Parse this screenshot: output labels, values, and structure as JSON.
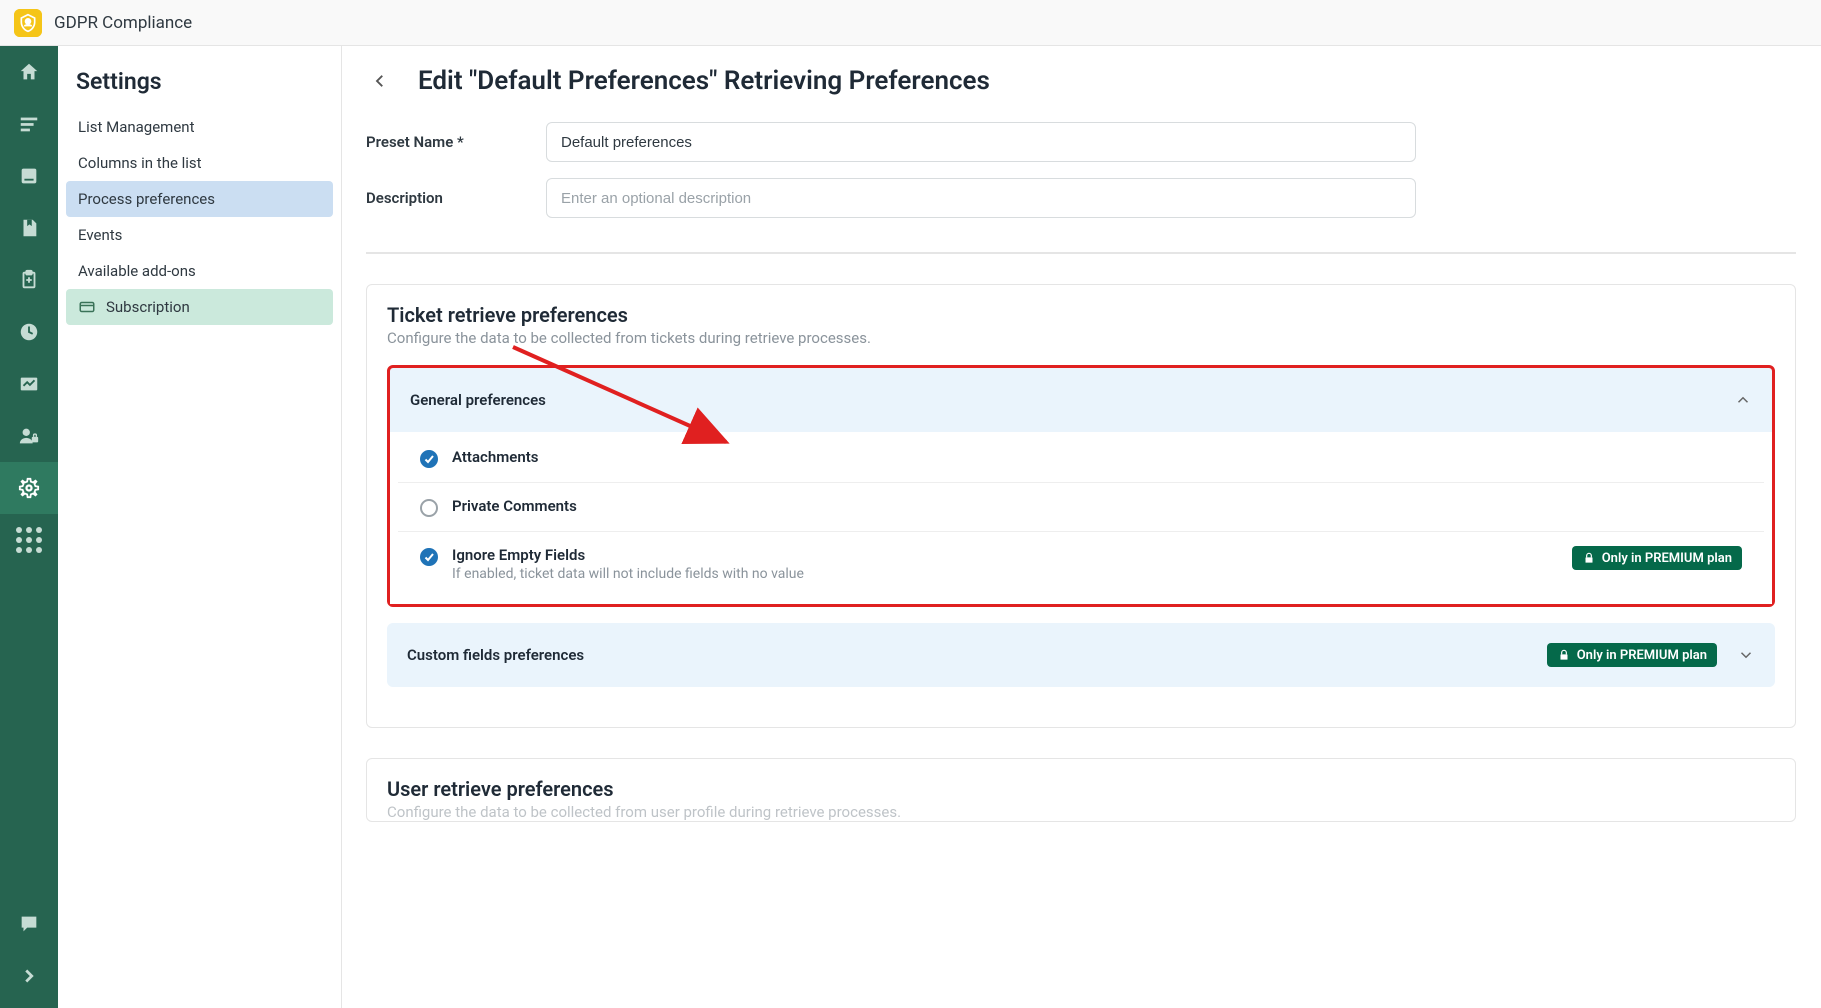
{
  "header": {
    "app_name": "GDPR Compliance"
  },
  "rail": {
    "items_top": [
      {
        "name": "home-icon"
      },
      {
        "name": "list-icon"
      },
      {
        "name": "card-icon"
      },
      {
        "name": "book-icon"
      },
      {
        "name": "clipboard-icon"
      },
      {
        "name": "clock-icon"
      },
      {
        "name": "chart-icon"
      },
      {
        "name": "user-lock-icon"
      },
      {
        "name": "gear-icon",
        "active": true
      },
      {
        "name": "apps-icon"
      }
    ],
    "items_bottom": [
      {
        "name": "chat-icon"
      },
      {
        "name": "collapse-icon"
      }
    ]
  },
  "sidebar": {
    "title": "Settings",
    "items": [
      {
        "label": "List Management"
      },
      {
        "label": "Columns in the list"
      },
      {
        "label": "Process preferences",
        "selected": true
      },
      {
        "label": "Events"
      },
      {
        "label": "Available add-ons"
      },
      {
        "label": "Subscription",
        "icon": "credit-card-icon",
        "sub": true
      }
    ]
  },
  "page": {
    "title": "Edit \"Default Preferences\" Retrieving Preferences",
    "form": {
      "preset_label": "Preset Name *",
      "preset_value": "Default preferences",
      "desc_label": "Description",
      "desc_placeholder": "Enter an optional description"
    },
    "ticket_panel": {
      "title": "Ticket retrieve preferences",
      "desc": "Configure the data to be collected from tickets during retrieve processes.",
      "general": {
        "title": "General preferences",
        "options": [
          {
            "label": "Attachments",
            "checked": true
          },
          {
            "label": "Private Comments",
            "checked": false
          },
          {
            "label": "Ignore Empty Fields",
            "checked": true,
            "sub": "If enabled, ticket data will not include fields with no value",
            "premium": true
          }
        ]
      },
      "custom": {
        "title": "Custom fields preferences",
        "premium": true
      }
    },
    "user_panel": {
      "title": "User retrieve preferences",
      "desc": "Configure the data to be collected from user profile during retrieve processes."
    },
    "premium_label": "Only in PREMIUM plan"
  }
}
